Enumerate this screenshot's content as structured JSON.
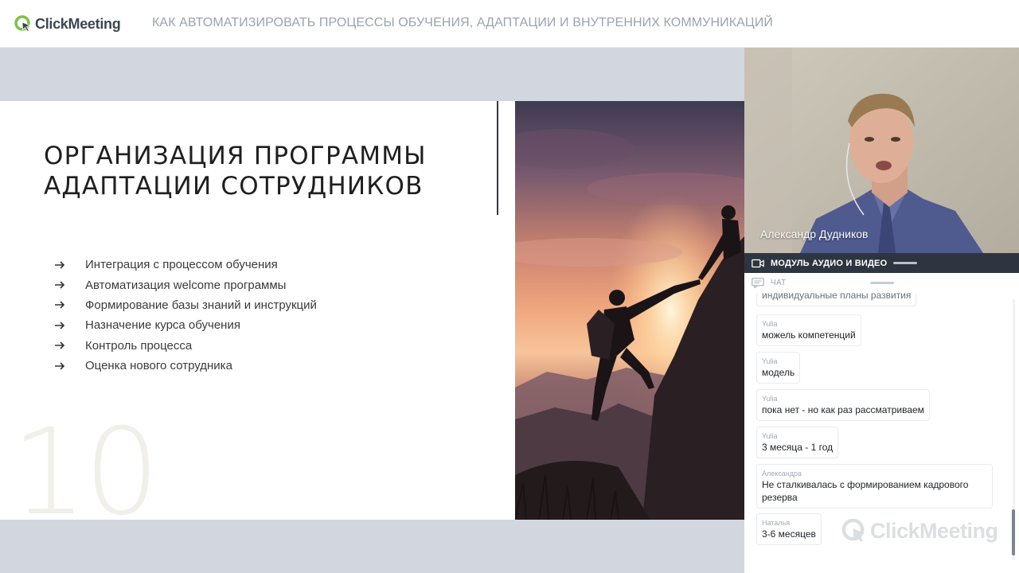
{
  "header": {
    "logo_text": "ClickMeeting",
    "meeting_title": "КАК АВТОМАТИЗИРОВАТЬ ПРОЦЕССЫ ОБУЧЕНИЯ, АДАПТАЦИИ И ВНУТРЕННИХ КОММУНИКАЦИЙ"
  },
  "slide": {
    "heading_line1": "ОРГАНИЗАЦИЯ ПРОГРАММЫ",
    "heading_line2": "АДАПТАЦИИ СОТРУДНИКОВ",
    "bullets": [
      "Интеграция с процессом обучения",
      "Автоматизация welcome программы",
      "Формирование базы знаний и инструкций",
      "Назначение курса обучения",
      "Контроль процесса",
      "Оценка нового сотрудника"
    ],
    "page_number": "10"
  },
  "video": {
    "presenter_name": "Александр Дудников"
  },
  "panels": {
    "av_label": "МОДУЛЬ АУДИО И ВИДЕО",
    "chat_label": "ЧАТ"
  },
  "chat": {
    "messages": [
      {
        "author": "",
        "text": "индивидуальные планы развития"
      },
      {
        "author": "Yulia",
        "text": "можель компетенций"
      },
      {
        "author": "Yulia",
        "text": "модель"
      },
      {
        "author": "Yulia",
        "text": "пока нет - но как раз рассматриваем"
      },
      {
        "author": "Yulia",
        "text": "3 месяца - 1 год"
      },
      {
        "author": "Александра",
        "text": "Не сталкивалась с формированием кадрового резерва"
      },
      {
        "author": "Наталья",
        "text": "3-6 месяцев"
      }
    ]
  },
  "watermark": {
    "text": "ClickMeeting"
  },
  "colors": {
    "brand_green": "#7dc242",
    "brand_dark": "#3c4652",
    "stage_bg": "#d2d6df",
    "av_bar_bg": "#2f3540"
  }
}
